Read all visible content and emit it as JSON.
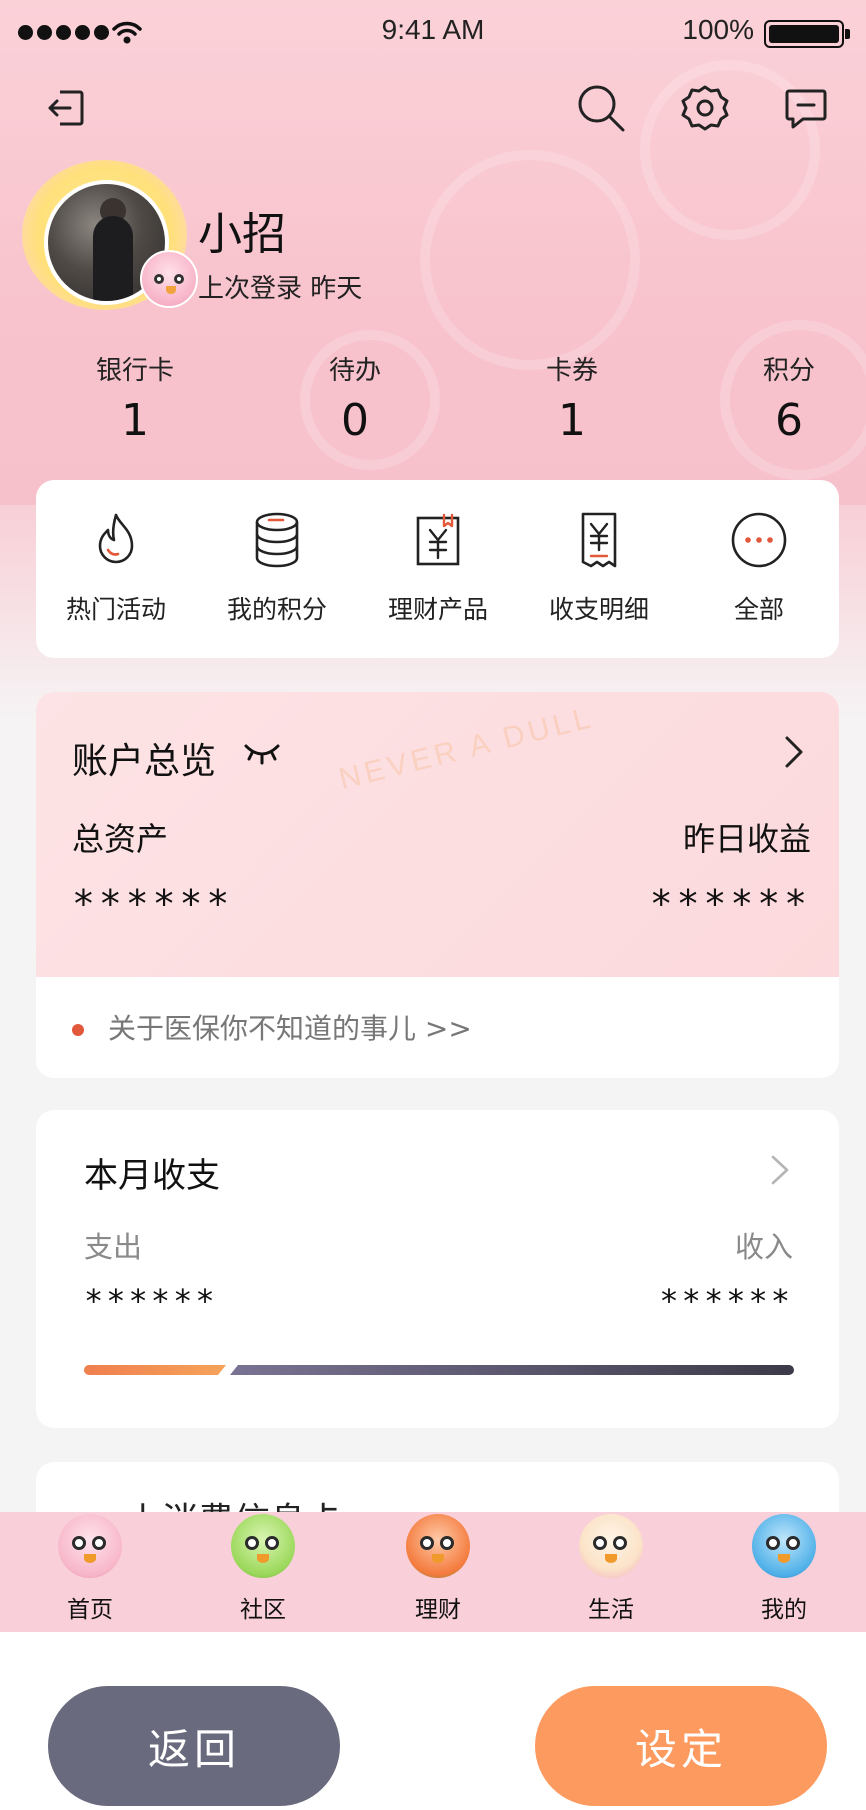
{
  "status_bar": {
    "time": "9:41 AM",
    "battery": "100%",
    "battery_level": 1.0
  },
  "header": {
    "icons": [
      "logout-icon",
      "search-icon",
      "settings-icon",
      "message-icon"
    ]
  },
  "profile": {
    "name": "小招",
    "last_login": "上次登录 昨天"
  },
  "stats": [
    {
      "label": "银行卡",
      "value": "1"
    },
    {
      "label": "待办",
      "value": "0"
    },
    {
      "label": "卡券",
      "value": "1"
    },
    {
      "label": "积分",
      "value": "6"
    }
  ],
  "quick_actions": [
    {
      "label": "热门活动",
      "icon": "fire-icon"
    },
    {
      "label": "我的积分",
      "icon": "coins-icon"
    },
    {
      "label": "理财产品",
      "icon": "finance-product-icon"
    },
    {
      "label": "收支明细",
      "icon": "receipt-icon"
    },
    {
      "label": "全部",
      "icon": "more-icon"
    }
  ],
  "account_overview": {
    "title": "账户总览",
    "watermark": "NEVER A DULL",
    "total_assets_label": "总资产",
    "yesterday_income_label": "昨日收益",
    "total_assets_value": "******",
    "yesterday_income_value": "******",
    "notice": "关于医保你不知道的事儿 >>"
  },
  "monthly": {
    "title": "本月收支",
    "expense_label": "支出",
    "income_label": "收入",
    "expense_value": "******",
    "income_value": "******",
    "expense_ratio": 0.2
  },
  "next_card_peek": "上消费信息卡",
  "tabs": [
    {
      "label": "首页",
      "color": "#f7b6c9"
    },
    {
      "label": "社区",
      "color": "#9bd85a"
    },
    {
      "label": "理财",
      "color": "#f47a3c"
    },
    {
      "label": "生活",
      "color": "#fbe3c8"
    },
    {
      "label": "我的",
      "color": "#4fb0e8"
    }
  ],
  "buttons": {
    "back": "返回",
    "confirm": "设定"
  },
  "colors": {
    "back_button": "#6a6a7e",
    "confirm_button": "#fd9a5f",
    "accent_dot": "#e2583a"
  }
}
